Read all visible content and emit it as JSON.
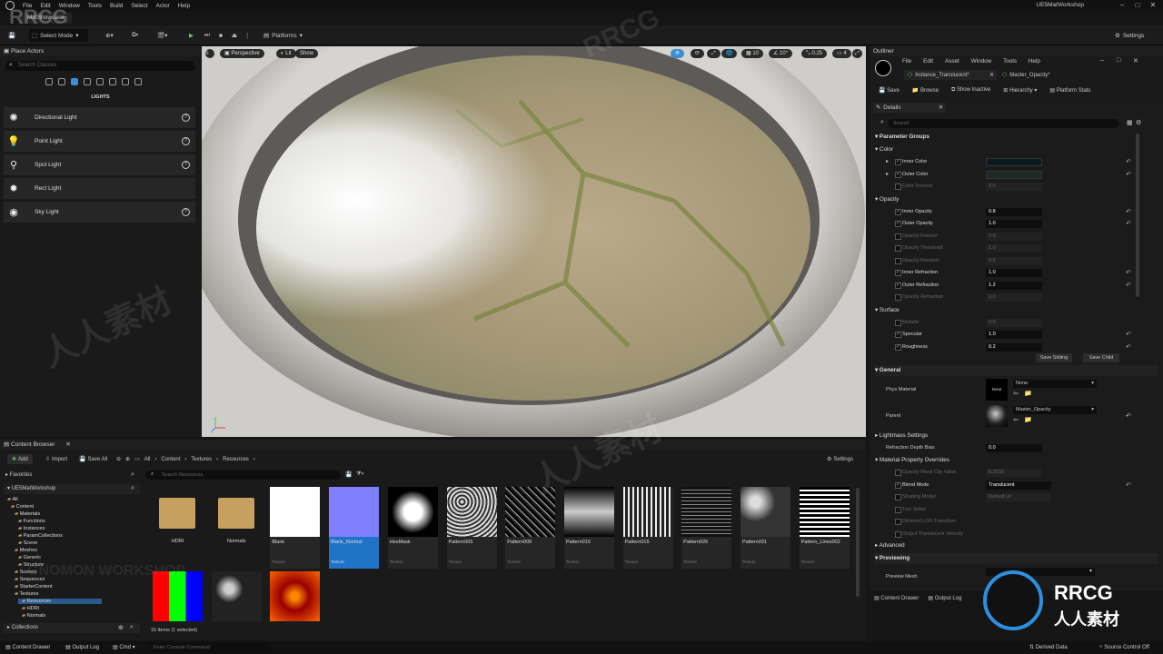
{
  "menubar": {
    "items": [
      "File",
      "Edit",
      "Window",
      "Tools",
      "Build",
      "Select",
      "Actor",
      "Help"
    ],
    "app_title": "UE5MatWorkshop"
  },
  "tab": {
    "label": "MatShowcase"
  },
  "toolbar": {
    "mode": "Select Mode",
    "platforms": "Platforms",
    "settings": "Settings"
  },
  "place_actors": {
    "title": "Place Actors",
    "search_placeholder": "Search Classes",
    "category": "LIGHTS",
    "items": [
      {
        "label": "Directional Light"
      },
      {
        "label": "Point Light"
      },
      {
        "label": "Spot Light"
      },
      {
        "label": "Rect Light"
      },
      {
        "label": "Sky Light"
      }
    ]
  },
  "viewport": {
    "perspective": "Perspective",
    "lit": "Lit",
    "show": "Show",
    "grid": "10",
    "angle": "10°",
    "scale": "0.25",
    "cams": "4"
  },
  "material_editor": {
    "outliner_tab": "Outliner",
    "menu": [
      "File",
      "Edit",
      "Asset",
      "Window",
      "Tools",
      "Help"
    ],
    "tabs": [
      "Instance_Translucent*",
      "Master_Opacity*"
    ],
    "toolbar": [
      "Save",
      "Browse",
      "Show Inactive",
      "Hierarchy",
      "Platform Stats"
    ]
  },
  "details": {
    "title": "Details",
    "search_placeholder": "Search",
    "parameter_groups": "Parameter Groups",
    "groups": [
      {
        "name": "Color",
        "props": [
          {
            "label": "Inner Color",
            "value": "",
            "checked": true,
            "disabled": false,
            "color": "#0b1a1e"
          },
          {
            "label": "Outer Color",
            "value": "",
            "checked": true,
            "disabled": false,
            "color": "#1e2826"
          },
          {
            "label": "Color Fresnel",
            "value": "2.0",
            "checked": false,
            "disabled": true
          }
        ]
      },
      {
        "name": "Opacity",
        "props": [
          {
            "label": "Inner Opacity",
            "value": "0.8",
            "checked": true,
            "disabled": false
          },
          {
            "label": "Outer Opacity",
            "value": "1.0",
            "checked": true,
            "disabled": false
          },
          {
            "label": "Opacity Fresnel",
            "value": "2.0",
            "checked": false,
            "disabled": true
          },
          {
            "label": "Opacity Threshold",
            "value": "1.0",
            "checked": false,
            "disabled": true
          },
          {
            "label": "Opacity Random",
            "value": "0.5",
            "checked": false,
            "disabled": true
          },
          {
            "label": "Inner Refraction",
            "value": "1.0",
            "checked": true,
            "disabled": false
          },
          {
            "label": "Outer Refraction",
            "value": "1.2",
            "checked": true,
            "disabled": false
          },
          {
            "label": "Opacity Refraction",
            "value": "2.0",
            "checked": false,
            "disabled": true
          }
        ]
      },
      {
        "name": "Surface",
        "props": [
          {
            "label": "Metallic",
            "value": "0.0",
            "checked": false,
            "disabled": true
          },
          {
            "label": "Specular",
            "value": "1.0",
            "checked": true,
            "disabled": false
          },
          {
            "label": "Roughness",
            "value": "0.2",
            "checked": true,
            "disabled": false
          }
        ]
      }
    ],
    "save_sibling": "Save Sibling",
    "save_child": "Save Child",
    "general": {
      "title": "General",
      "phys_material_label": "Phys Material",
      "phys_material_value": "None",
      "phys_thumb": "None",
      "parent_label": "Parent",
      "parent_value": "Master_Opacity"
    },
    "lightmass": "Lightmass Settings",
    "refraction_depth_label": "Refraction Depth Bias",
    "refraction_depth_value": "0.0",
    "mpo": {
      "title": "Material Property Overrides",
      "rows": [
        {
          "label": "Opacity Mask Clip Value",
          "value": "0.3333",
          "checked": false,
          "disabled": true
        },
        {
          "label": "Blend Mode",
          "value": "Translucent",
          "checked": true,
          "disabled": false
        },
        {
          "label": "Shading Model",
          "value": "Default Lit",
          "checked": false,
          "disabled": true
        },
        {
          "label": "Two Sided",
          "value": "",
          "checked": false,
          "disabled": true
        },
        {
          "label": "Dithered LOD Transition",
          "value": "",
          "checked": false,
          "disabled": true
        },
        {
          "label": "Output Translucent Velocity",
          "value": "",
          "checked": false,
          "disabled": true
        }
      ]
    },
    "advanced": "Advanced",
    "previewing": "Previewing",
    "preview_mesh": "Preview Mesh",
    "bottom_tabs": [
      "Content Drawer",
      "Output Log"
    ]
  },
  "content_browser": {
    "title": "Content Browser",
    "add": "Add",
    "import": "Import",
    "save_all": "Save All",
    "breadcrumb": [
      "All",
      "Content",
      "Textures",
      "Resources"
    ],
    "settings": "Settings",
    "favorites": "Favorites",
    "project": "UE5MatWorkshop",
    "search_placeholder": "Search Resources",
    "tree": [
      "All",
      "Content",
      "Materials",
      "Functions",
      "Instances",
      "ParamCollections",
      "Scene",
      "Meshes",
      "Generic",
      "Structure",
      "Scenes",
      "Sequences",
      "StarterContent",
      "Textures",
      "Resources",
      "HDRI",
      "Normals"
    ],
    "assets": [
      {
        "name": "HDRI",
        "type": ""
      },
      {
        "name": "Normals",
        "type": ""
      },
      {
        "name": "Blank",
        "type": "Texture"
      },
      {
        "name": "Blank_Normal",
        "type": "Texture"
      },
      {
        "name": "HexMask",
        "type": "Texture"
      },
      {
        "name": "Pattern005",
        "type": "Texture"
      },
      {
        "name": "Pattern009",
        "type": "Texture"
      },
      {
        "name": "Pattern010",
        "type": "Texture"
      },
      {
        "name": "Pattern015",
        "type": "Texture"
      },
      {
        "name": "Pattern026",
        "type": "Texture"
      },
      {
        "name": "Pattern031",
        "type": "Texture"
      },
      {
        "name": "Pattern_Lines002",
        "type": "Texture"
      }
    ],
    "item_count": "15 items (1 selected)",
    "collections": "Collections"
  },
  "statusbar": {
    "content_drawer": "Content Drawer",
    "output_log": "Output Log",
    "cmd": "Cmd",
    "console_placeholder": "Enter Console Command",
    "derived_data": "Derived Data",
    "source_control": "Source Control Off"
  },
  "watermarks": [
    "RRCG",
    "人人素材",
    "GNOMON WORKSHOP"
  ]
}
